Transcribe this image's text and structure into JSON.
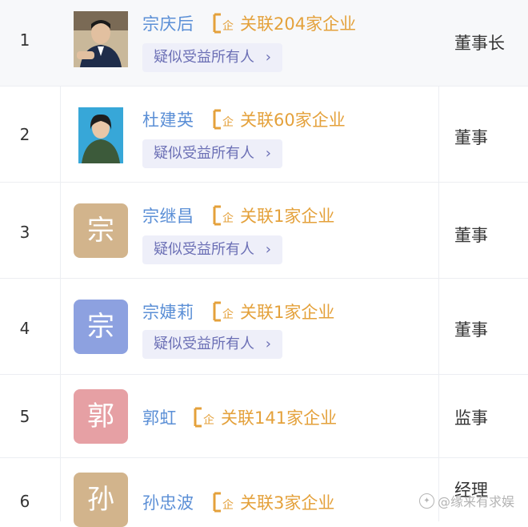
{
  "rows": [
    {
      "index": "1",
      "name": "宗庆后",
      "relation": "关联204家企业",
      "tag": "疑似受益所有人",
      "tag_chevron": "›",
      "role": "董事长",
      "avatar": {
        "type": "photo"
      }
    },
    {
      "index": "2",
      "name": "杜建英",
      "relation": "关联60家企业",
      "tag": "疑似受益所有人",
      "tag_chevron": "›",
      "role": "董事",
      "avatar": {
        "type": "photo"
      }
    },
    {
      "index": "3",
      "name": "宗继昌",
      "relation": "关联1家企业",
      "tag": "疑似受益所有人",
      "tag_chevron": "›",
      "role": "董事",
      "avatar": {
        "type": "char",
        "char": "宗",
        "color": "#d2b48c"
      }
    },
    {
      "index": "4",
      "name": "宗婕莉",
      "relation": "关联1家企业",
      "tag": "疑似受益所有人",
      "tag_chevron": "›",
      "role": "董事",
      "avatar": {
        "type": "char",
        "char": "宗",
        "color": "#8da1e0"
      }
    },
    {
      "index": "5",
      "name": "郭虹",
      "relation": "关联141家企业",
      "role": "监事",
      "avatar": {
        "type": "char",
        "char": "郭",
        "color": "#e6a0a4"
      }
    },
    {
      "index": "6",
      "name": "孙忠波",
      "relation": "关联3家企业",
      "role": "经理",
      "avatar": {
        "type": "char",
        "char": "孙",
        "color": "#d2b48c"
      }
    }
  ],
  "colors": {
    "name": "#5b8fd6",
    "relation": "#e4a13b",
    "tag_bg": "#eeeff9",
    "tag_text": "#6b6fb5"
  },
  "icons": {
    "relation": "enterprise-link-icon",
    "chevron": "chevron-right-icon"
  },
  "watermark": {
    "text": "@缘来有求娱"
  }
}
